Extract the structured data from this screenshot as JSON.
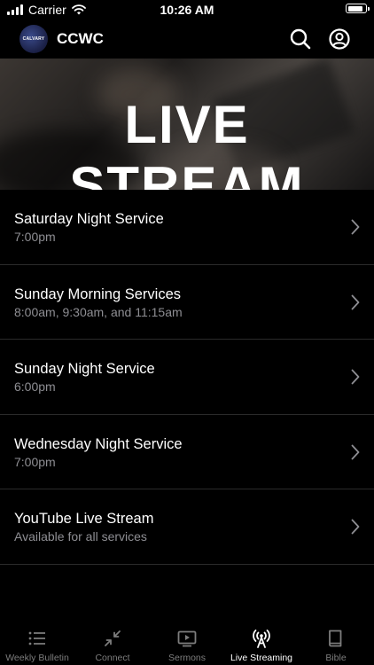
{
  "status_bar": {
    "carrier": "Carrier",
    "time": "10:26 AM",
    "battery_level": 0.9
  },
  "header": {
    "logo_text": "CALVARY",
    "app_title": "CCWC",
    "search_icon": "search-icon",
    "account_icon": "account-icon"
  },
  "hero": {
    "title": "LIVE STREAM"
  },
  "services": [
    {
      "title": "Saturday Night Service",
      "time": "7:00pm"
    },
    {
      "title": "Sunday Morning Services",
      "time": "8:00am, 9:30am, and 11:15am"
    },
    {
      "title": "Sunday Night Service",
      "time": "6:00pm"
    },
    {
      "title": "Wednesday Night Service",
      "time": "7:00pm"
    },
    {
      "title": "YouTube Live Stream",
      "time": "Available for all services"
    }
  ],
  "tabs": [
    {
      "label": "Weekly Bulletin",
      "icon": "list-icon",
      "active": false
    },
    {
      "label": "Connect",
      "icon": "arrows-in-icon",
      "active": false
    },
    {
      "label": "Sermons",
      "icon": "video-play-icon",
      "active": false
    },
    {
      "label": "Live Streaming",
      "icon": "broadcast-tower-icon",
      "active": true
    },
    {
      "label": "Bible",
      "icon": "book-icon",
      "active": false
    }
  ],
  "colors": {
    "background": "#000000",
    "text_primary": "#ffffff",
    "text_secondary": "#8e8e93",
    "separator": "#2a2a2a",
    "tab_inactive": "#7d7d7d"
  }
}
